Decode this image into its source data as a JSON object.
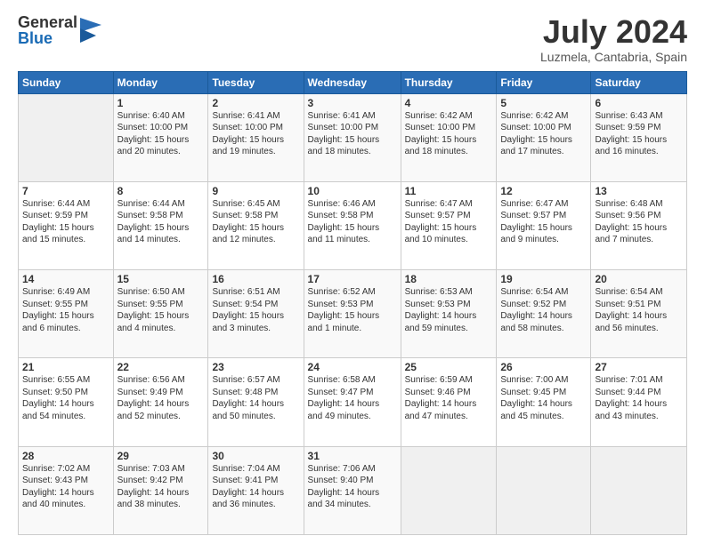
{
  "logo": {
    "general": "General",
    "blue": "Blue"
  },
  "title": "July 2024",
  "location": "Luzmela, Cantabria, Spain",
  "days_header": [
    "Sunday",
    "Monday",
    "Tuesday",
    "Wednesday",
    "Thursday",
    "Friday",
    "Saturday"
  ],
  "weeks": [
    [
      {
        "num": "",
        "info": ""
      },
      {
        "num": "1",
        "info": "Sunrise: 6:40 AM\nSunset: 10:00 PM\nDaylight: 15 hours\nand 20 minutes."
      },
      {
        "num": "2",
        "info": "Sunrise: 6:41 AM\nSunset: 10:00 PM\nDaylight: 15 hours\nand 19 minutes."
      },
      {
        "num": "3",
        "info": "Sunrise: 6:41 AM\nSunset: 10:00 PM\nDaylight: 15 hours\nand 18 minutes."
      },
      {
        "num": "4",
        "info": "Sunrise: 6:42 AM\nSunset: 10:00 PM\nDaylight: 15 hours\nand 18 minutes."
      },
      {
        "num": "5",
        "info": "Sunrise: 6:42 AM\nSunset: 10:00 PM\nDaylight: 15 hours\nand 17 minutes."
      },
      {
        "num": "6",
        "info": "Sunrise: 6:43 AM\nSunset: 9:59 PM\nDaylight: 15 hours\nand 16 minutes."
      }
    ],
    [
      {
        "num": "7",
        "info": "Sunrise: 6:44 AM\nSunset: 9:59 PM\nDaylight: 15 hours\nand 15 minutes."
      },
      {
        "num": "8",
        "info": "Sunrise: 6:44 AM\nSunset: 9:58 PM\nDaylight: 15 hours\nand 14 minutes."
      },
      {
        "num": "9",
        "info": "Sunrise: 6:45 AM\nSunset: 9:58 PM\nDaylight: 15 hours\nand 12 minutes."
      },
      {
        "num": "10",
        "info": "Sunrise: 6:46 AM\nSunset: 9:58 PM\nDaylight: 15 hours\nand 11 minutes."
      },
      {
        "num": "11",
        "info": "Sunrise: 6:47 AM\nSunset: 9:57 PM\nDaylight: 15 hours\nand 10 minutes."
      },
      {
        "num": "12",
        "info": "Sunrise: 6:47 AM\nSunset: 9:57 PM\nDaylight: 15 hours\nand 9 minutes."
      },
      {
        "num": "13",
        "info": "Sunrise: 6:48 AM\nSunset: 9:56 PM\nDaylight: 15 hours\nand 7 minutes."
      }
    ],
    [
      {
        "num": "14",
        "info": "Sunrise: 6:49 AM\nSunset: 9:55 PM\nDaylight: 15 hours\nand 6 minutes."
      },
      {
        "num": "15",
        "info": "Sunrise: 6:50 AM\nSunset: 9:55 PM\nDaylight: 15 hours\nand 4 minutes."
      },
      {
        "num": "16",
        "info": "Sunrise: 6:51 AM\nSunset: 9:54 PM\nDaylight: 15 hours\nand 3 minutes."
      },
      {
        "num": "17",
        "info": "Sunrise: 6:52 AM\nSunset: 9:53 PM\nDaylight: 15 hours\nand 1 minute."
      },
      {
        "num": "18",
        "info": "Sunrise: 6:53 AM\nSunset: 9:53 PM\nDaylight: 14 hours\nand 59 minutes."
      },
      {
        "num": "19",
        "info": "Sunrise: 6:54 AM\nSunset: 9:52 PM\nDaylight: 14 hours\nand 58 minutes."
      },
      {
        "num": "20",
        "info": "Sunrise: 6:54 AM\nSunset: 9:51 PM\nDaylight: 14 hours\nand 56 minutes."
      }
    ],
    [
      {
        "num": "21",
        "info": "Sunrise: 6:55 AM\nSunset: 9:50 PM\nDaylight: 14 hours\nand 54 minutes."
      },
      {
        "num": "22",
        "info": "Sunrise: 6:56 AM\nSunset: 9:49 PM\nDaylight: 14 hours\nand 52 minutes."
      },
      {
        "num": "23",
        "info": "Sunrise: 6:57 AM\nSunset: 9:48 PM\nDaylight: 14 hours\nand 50 minutes."
      },
      {
        "num": "24",
        "info": "Sunrise: 6:58 AM\nSunset: 9:47 PM\nDaylight: 14 hours\nand 49 minutes."
      },
      {
        "num": "25",
        "info": "Sunrise: 6:59 AM\nSunset: 9:46 PM\nDaylight: 14 hours\nand 47 minutes."
      },
      {
        "num": "26",
        "info": "Sunrise: 7:00 AM\nSunset: 9:45 PM\nDaylight: 14 hours\nand 45 minutes."
      },
      {
        "num": "27",
        "info": "Sunrise: 7:01 AM\nSunset: 9:44 PM\nDaylight: 14 hours\nand 43 minutes."
      }
    ],
    [
      {
        "num": "28",
        "info": "Sunrise: 7:02 AM\nSunset: 9:43 PM\nDaylight: 14 hours\nand 40 minutes."
      },
      {
        "num": "29",
        "info": "Sunrise: 7:03 AM\nSunset: 9:42 PM\nDaylight: 14 hours\nand 38 minutes."
      },
      {
        "num": "30",
        "info": "Sunrise: 7:04 AM\nSunset: 9:41 PM\nDaylight: 14 hours\nand 36 minutes."
      },
      {
        "num": "31",
        "info": "Sunrise: 7:06 AM\nSunset: 9:40 PM\nDaylight: 14 hours\nand 34 minutes."
      },
      {
        "num": "",
        "info": ""
      },
      {
        "num": "",
        "info": ""
      },
      {
        "num": "",
        "info": ""
      }
    ]
  ]
}
